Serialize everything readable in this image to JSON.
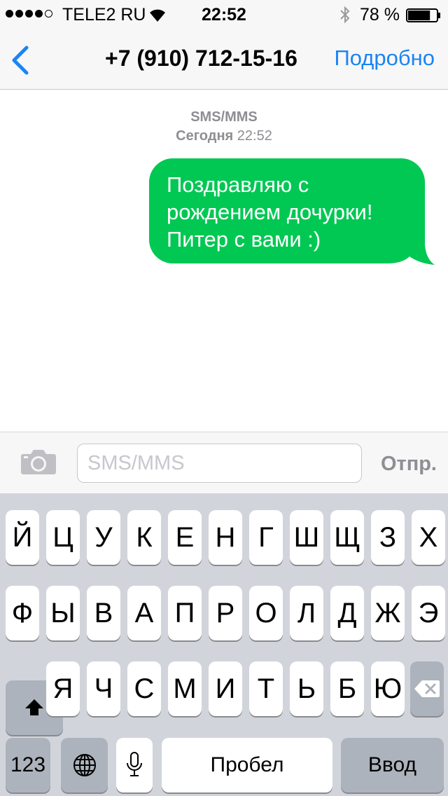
{
  "status_bar": {
    "carrier": "TELE2 RU",
    "signal_filled": 4,
    "signal_total": 5,
    "time": "22:52",
    "battery_percent": "78 %",
    "battery_level": 0.78
  },
  "nav": {
    "back_icon": "chevron-left-icon",
    "title": "+7 (910) 712-15-16",
    "details": "Подробно"
  },
  "conversation": {
    "message_type": "SMS/MMS",
    "date_label": "Сегодня",
    "date_time": "22:52",
    "messages": [
      {
        "direction": "outgoing",
        "text": "Поздравляю с рождением дочурки! Питер с вами :)"
      }
    ]
  },
  "composer": {
    "camera_icon": "camera-icon",
    "placeholder": "SMS/MMS",
    "value": "",
    "send_label": "Отпр."
  },
  "keyboard": {
    "row1": [
      "Й",
      "Ц",
      "У",
      "К",
      "Е",
      "Н",
      "Г",
      "Ш",
      "Щ",
      "З",
      "Х"
    ],
    "row2": [
      "Ф",
      "Ы",
      "В",
      "А",
      "П",
      "Р",
      "О",
      "Л",
      "Д",
      "Ж",
      "Э"
    ],
    "row3": [
      "Я",
      "Ч",
      "С",
      "М",
      "И",
      "Т",
      "Ь",
      "Б",
      "Ю"
    ],
    "numbers_label": "123",
    "space_label": "Пробел",
    "return_label": "Ввод"
  },
  "colors": {
    "accent": "#1a84f4",
    "bubble": "#00c853",
    "keyboard_bg": "#d1d5db"
  }
}
